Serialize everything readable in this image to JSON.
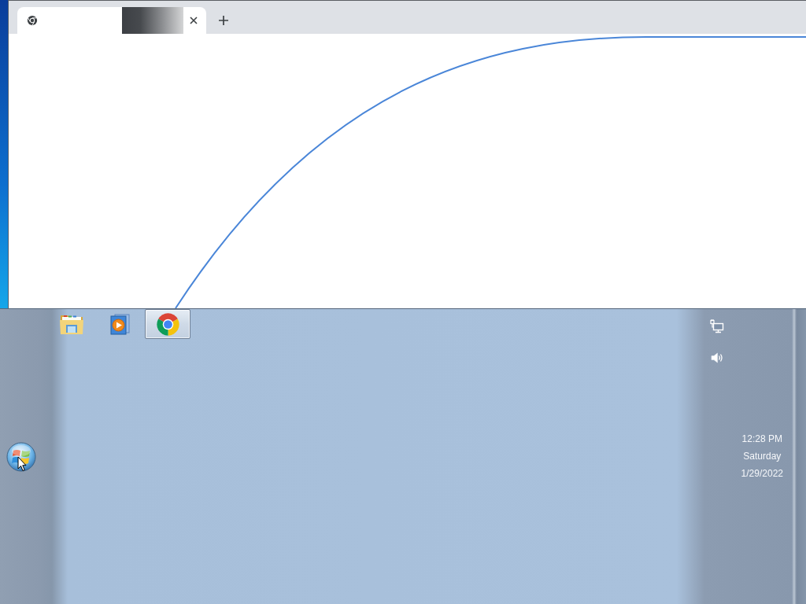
{
  "browser": {
    "tabs": [
      {
        "selected": true
      }
    ]
  },
  "taskbar": {
    "apps": [
      {
        "kind": "folder",
        "active": false
      },
      {
        "kind": "media",
        "active": false
      },
      {
        "kind": "browser",
        "active": true
      }
    ],
    "tray_icons": [
      {
        "kind": "network"
      },
      {
        "kind": "volume"
      }
    ],
    "clock": {
      "time": "12:28 PM",
      "day": "Saturday",
      "date": "1/29/2022"
    }
  }
}
